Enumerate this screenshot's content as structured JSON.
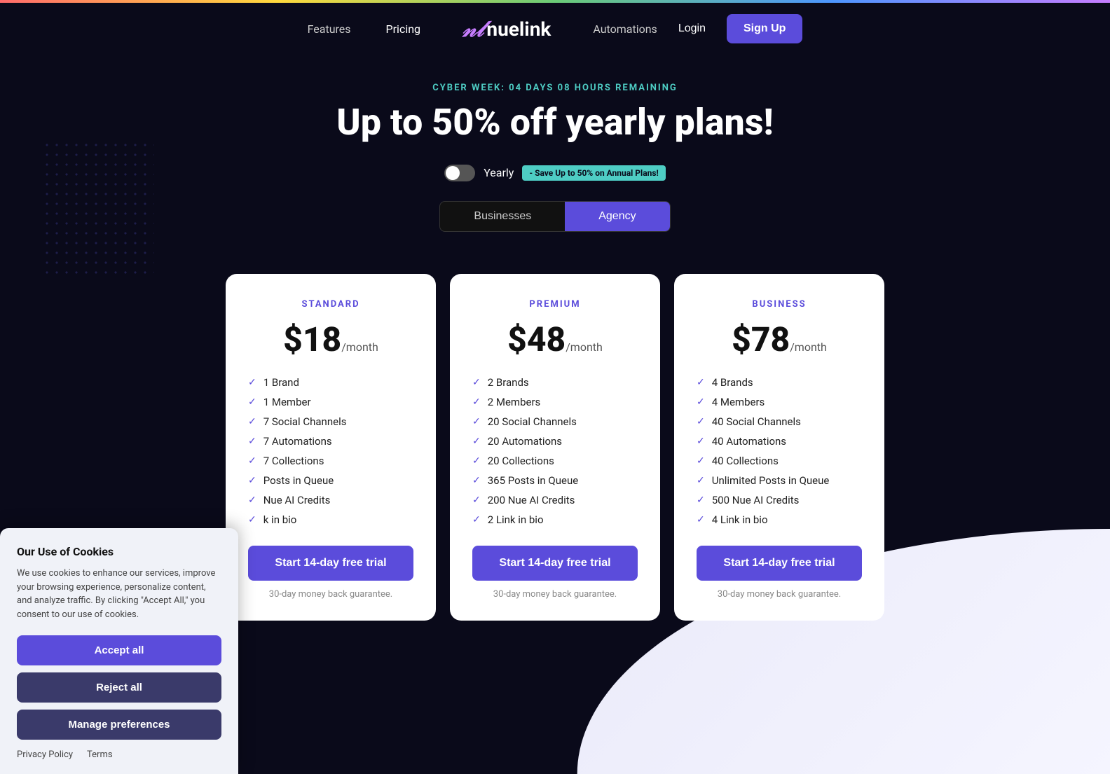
{
  "topbar": {},
  "nav": {
    "features_label": "Features",
    "pricing_label": "Pricing",
    "logo_text": "nuelink",
    "automations_label": "Automations",
    "login_label": "Login",
    "signup_label": "Sign Up"
  },
  "hero": {
    "cyber_badge": "CYBER WEEK: 04 DAYS 08 HOURS REMAINING",
    "title": "Up to 50% off yearly plans!",
    "toggle_label": "Yearly",
    "save_badge": "- Save Up to 50% on Annual Plans!"
  },
  "tabs": [
    {
      "id": "businesses",
      "label": "Businesses"
    },
    {
      "id": "agency",
      "label": "Agency"
    }
  ],
  "plans": [
    {
      "id": "standard",
      "plan_label": "STANDARD",
      "price": "$18",
      "period": "/month",
      "features": [
        "1 Brand",
        "1 Member",
        "7 Social Channels",
        "7 Automations",
        "7 Collections",
        "Posts in Queue",
        "Nue AI Credits",
        "k in bio"
      ],
      "trial_btn": "Start 14-day free trial",
      "money_back": "30-day money back guarantee."
    },
    {
      "id": "premium",
      "plan_label": "PREMIUM",
      "price": "$48",
      "period": "/month",
      "features": [
        "2 Brands",
        "2 Members",
        "20 Social Channels",
        "20 Automations",
        "20 Collections",
        "365 Posts in Queue",
        "200 Nue AI Credits",
        "2 Link in bio"
      ],
      "trial_btn": "Start 14-day free trial",
      "money_back": "30-day money back guarantee."
    },
    {
      "id": "business",
      "plan_label": "BUSINESS",
      "price": "$78",
      "period": "/month",
      "features": [
        "4 Brands",
        "4 Members",
        "40 Social Channels",
        "40 Automations",
        "40 Collections",
        "Unlimited Posts in Queue",
        "500 Nue AI Credits",
        "4 Link in bio"
      ],
      "trial_btn": "Start 14-day free trial",
      "money_back": "30-day money back guarantee."
    }
  ],
  "cookie": {
    "title": "Our Use of Cookies",
    "description": "We use cookies to enhance our services, improve your browsing experience, personalize content, and analyze traffic. By clicking \"Accept All,\" you consent to our use of cookies.",
    "accept_btn": "Accept all",
    "reject_btn": "Reject all",
    "manage_btn": "Manage preferences",
    "privacy_label": "Privacy Policy",
    "terms_label": "Terms"
  }
}
